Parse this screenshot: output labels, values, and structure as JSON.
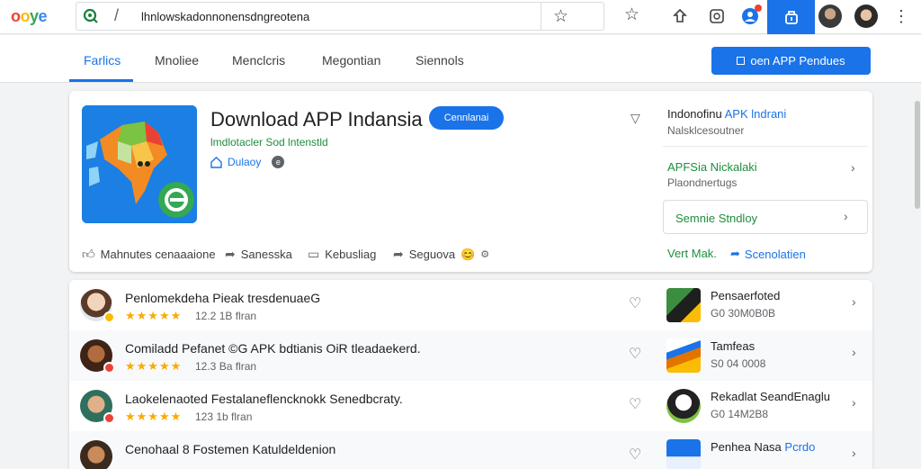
{
  "browser": {
    "logo": [
      "o",
      "o",
      "y",
      "e"
    ],
    "url": "lhnlowskadonnonensdngreotena",
    "separator": "/"
  },
  "nav": {
    "tabs": [
      "Farlics",
      "Mnoliee",
      "Menclcris",
      "Megontian",
      "Siennols"
    ],
    "active_tab": 0,
    "button_label": "oen APP Pendues"
  },
  "app": {
    "title": "Download APP Indansia",
    "badge": "Cennlanai",
    "developer": "lmdlotacler Sod lntenstld",
    "category": "Dulaoy",
    "actions": [
      "Mahnutes cenaaaione",
      "Sanesska",
      "Kebusliag",
      "Seguova"
    ]
  },
  "side_panel": {
    "title_prefix": "Indonofinu",
    "title_highlight": "APK lndrani",
    "subtitle": "Nalsklcesoutner",
    "row2_title": "APFSia Nickalaki",
    "row2_sub": "Plaondnertugs",
    "box_label": "Semnie Stndloy",
    "footer_a": "Vert Mak.",
    "footer_b": "Scenolatien"
  },
  "list": [
    {
      "title": "Penlomekdeha Pieak tresdenuaeG",
      "stars": "★★★★★",
      "meta": "12.2 1B flran",
      "right_title": "Pensaerfoted",
      "right_highlight": "",
      "right_meta": "G0 30M0B0B"
    },
    {
      "title": "Comiladd Pefanet ©G APK bdtianis OiR tleadaekerd.",
      "stars": "★★★★★",
      "meta": "12.3 Ba flran",
      "right_title": "Tamfeas",
      "right_highlight": "",
      "right_meta": "S0 04 0008"
    },
    {
      "title": "Laokelenaoted Festalaneflencknokk Senedbcraty.",
      "stars": "★★★★★",
      "meta": "123 1b flran",
      "right_title": "Rekadlat SeandEnaglu",
      "right_highlight": "",
      "right_meta": "G0 14M2B8"
    },
    {
      "title": "Cenohaal 8 Fostemen Katuldeldenion",
      "stars": "★★★★★",
      "meta": "",
      "right_title": "Penhea Nasa",
      "right_highlight": "Pcrdo",
      "right_meta": ""
    }
  ],
  "colors": {
    "accent": "#1a73e8",
    "green": "#1e8e3e",
    "star": "#f9ab00"
  },
  "icons": {
    "search": "search-icon",
    "bookmark": "star-icon",
    "extensions": "puzzle-icon",
    "heart": "heart-icon"
  }
}
